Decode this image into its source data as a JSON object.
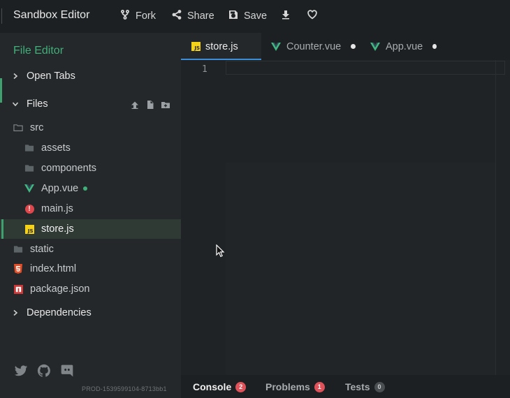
{
  "app": {
    "title": "Sandbox Editor"
  },
  "toolbar": {
    "fork_label": "Fork",
    "share_label": "Share",
    "save_label": "Save"
  },
  "sidebar": {
    "title": "File Editor",
    "open_tabs_label": "Open Tabs",
    "files_label": "Files",
    "dependencies_label": "Dependencies",
    "tree": [
      {
        "name": "src",
        "type": "folder-open",
        "depth": 0
      },
      {
        "name": "assets",
        "type": "folder",
        "depth": 1
      },
      {
        "name": "components",
        "type": "folder",
        "depth": 1
      },
      {
        "name": "App.vue",
        "type": "vue",
        "depth": 1,
        "modified": true
      },
      {
        "name": "main.js",
        "type": "error",
        "depth": 1
      },
      {
        "name": "store.js",
        "type": "js",
        "depth": 1,
        "selected": true
      },
      {
        "name": "static",
        "type": "folder",
        "depth": 0
      },
      {
        "name": "index.html",
        "type": "html",
        "depth": 0
      },
      {
        "name": "package.json",
        "type": "npm",
        "depth": 0
      }
    ],
    "build_id": "PROD-1539599104-8713bb1"
  },
  "editor": {
    "tabs": [
      {
        "label": "store.js",
        "icon": "js-icon",
        "active": true,
        "modified": false
      },
      {
        "label": "Counter.vue",
        "icon": "vue-icon",
        "active": false,
        "modified": true
      },
      {
        "label": "App.vue",
        "icon": "vue-icon",
        "active": false,
        "modified": true
      }
    ],
    "line_number": "1"
  },
  "bottom_panel": {
    "console_label": "Console",
    "console_count": "2",
    "problems_label": "Problems",
    "problems_count": "1",
    "tests_label": "Tests",
    "tests_count": "0"
  },
  "colors": {
    "accent_green": "#40b07a",
    "vue_green": "#41b883",
    "tab_underline": "#3a8fd8",
    "badge_red": "#e0525a",
    "js_yellow": "#f5d21a"
  }
}
